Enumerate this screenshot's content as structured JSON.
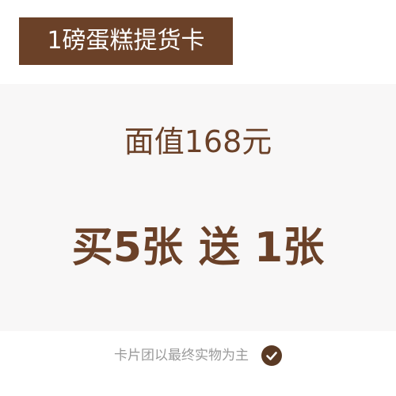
{
  "header": {
    "title": "1磅蛋糕提货卡"
  },
  "main": {
    "face_value": "面值168元",
    "promo_buy": "买5张",
    "promo_gift": "送 1张"
  },
  "footer": {
    "note": "卡片团以最终实物为主",
    "icon": "check-circle-icon"
  },
  "colors": {
    "brand": "#6b4128",
    "panel_background": "#f8f7f7",
    "muted_text": "#9a9a9a"
  }
}
